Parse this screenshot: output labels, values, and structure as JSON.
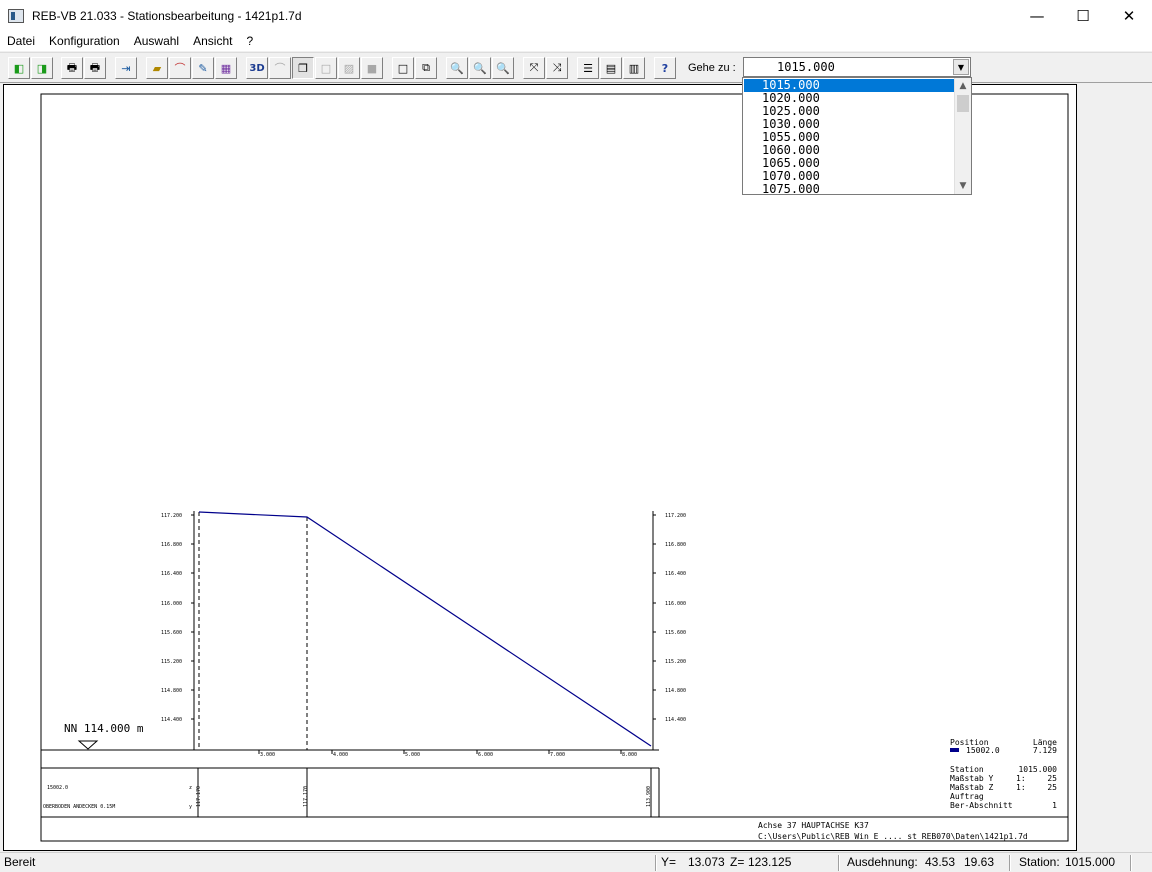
{
  "window": {
    "title": "REB-VB 21.033 - Stationsbearbeitung - 1421p1.7d",
    "minimize": "—",
    "maximize": "☐",
    "close": "✕"
  },
  "menu": [
    "Datei",
    "Konfiguration",
    "Auswahl",
    "Ansicht",
    "?"
  ],
  "toolbar": {
    "goto_label": "Gehe zu :",
    "goto_value": "1015.000",
    "buttons": [
      "prev-green",
      "next-green",
      "print",
      "print-setup",
      "export",
      "open-folder",
      "profile",
      "pencil",
      "grid-colors",
      "3d",
      "arc",
      "layers",
      "box",
      "hatch",
      "fill",
      "rect",
      "rect-arrow",
      "zoom-m",
      "zoom-f",
      "zoom-v",
      "fit",
      "extent",
      "list",
      "window",
      "table",
      "help"
    ]
  },
  "dropdown": {
    "items": [
      "1015.000",
      "1020.000",
      "1025.000",
      "1030.000",
      "1055.000",
      "1060.000",
      "1065.000",
      "1070.000",
      "1075.000"
    ],
    "selected_index": 0
  },
  "drawing": {
    "left_axis_labels": [
      "117.200",
      "116.800",
      "116.400",
      "116.000",
      "115.600",
      "115.200",
      "114.800",
      "114.400"
    ],
    "right_axis_labels": [
      "117.200",
      "116.800",
      "116.400",
      "116.000",
      "115.600",
      "115.200",
      "114.800",
      "114.400"
    ],
    "bottom_axis_labels": [
      "3.000",
      "4.000",
      "5.000",
      "6.000",
      "7.000",
      "8.000"
    ],
    "datum_label": "NN 114.000 m",
    "band_code": "15002.0",
    "band_z": "z",
    "band_y": "y",
    "band_desc": "OBERBODEN ANDECKEN 0.15M",
    "band_vals": [
      "117.170",
      "117.170",
      "113.900"
    ],
    "legend": {
      "position_header": "Position",
      "length_header": "Länge",
      "position_value": "15002.0",
      "length_value": "7.129",
      "station_label": "Station",
      "station_value": "1015.000",
      "scale_y_label": "Maßstab Y",
      "scale_y_ratio": "1:",
      "scale_y_value": "25",
      "scale_z_label": "Maßstab Z",
      "scale_z_ratio": "1:",
      "scale_z_value": "25",
      "auftrag_label": "Auftrag",
      "ber_label": "Ber-Abschnitt",
      "ber_value": "1"
    },
    "footer_line1": "Achse 37 HAUPTACHSE K37",
    "footer_line2": "C:\\Users\\Public\\REB Win E .... st REB070\\Daten\\1421p1.7d",
    "line_color": "#00008b",
    "legend_color": "#00008b"
  },
  "status": {
    "ready": "Bereit",
    "y_label": "Y=",
    "y_value": "13.073",
    "z_label": "Z=",
    "z_value": "123.125",
    "extent_label": "Ausdehnung:",
    "extent_x": "43.53",
    "extent_y": "19.63",
    "station_label": "Station:",
    "station_value": "1015.000"
  }
}
